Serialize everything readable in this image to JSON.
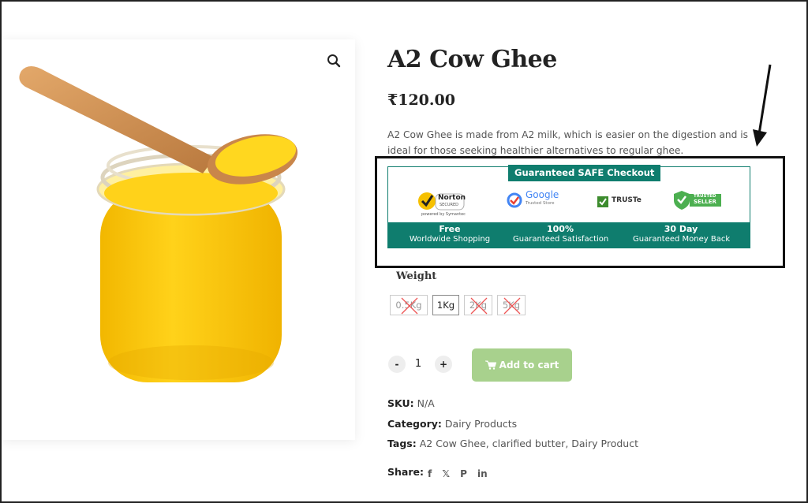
{
  "product": {
    "title": "A2 Cow Ghee",
    "price": "₹120.00",
    "description": "A2 Cow Ghee is made from A2 milk, which is easier on the digestion and is ideal for those seeking healthier alternatives to regular ghee."
  },
  "trust": {
    "heading": "Guaranteed SAFE Checkout",
    "logos": [
      {
        "name": "norton-secured-logo",
        "line1": "Norton",
        "line2": "SECURED",
        "line3": "powered by Symantec"
      },
      {
        "name": "google-trusted-store-logo",
        "line1": "Google",
        "line2": "Trusted Store"
      },
      {
        "name": "truste-logo",
        "line1": "TRUSTe"
      },
      {
        "name": "trusted-seller-logo",
        "line1": "TRUSTED",
        "line2": "SELLER"
      }
    ],
    "badges": [
      {
        "top": "Free",
        "sub": "Worldwide Shopping"
      },
      {
        "top": "100%",
        "sub": "Guaranteed Satisfaction"
      },
      {
        "top": "30 Day",
        "sub": "Guaranteed Money Back"
      }
    ]
  },
  "weight": {
    "label": "Weight",
    "options": [
      {
        "label": "0.5Kg",
        "available": false
      },
      {
        "label": "1Kg",
        "available": true
      },
      {
        "label": "2Kg",
        "available": false
      },
      {
        "label": "5Kg",
        "available": false
      }
    ]
  },
  "cart": {
    "minus": "-",
    "plus": "+",
    "quantity": "1",
    "add_label": "Add to cart"
  },
  "meta": {
    "sku_label": "SKU:",
    "sku_value": "N/A",
    "category_label": "Category:",
    "category_value": "Dairy Products",
    "tags_label": "Tags:",
    "tags": [
      "A2 Cow Ghee",
      "clarified butter",
      "Dairy Product"
    ],
    "share_label": "Share:",
    "share_icons": [
      "f",
      "𝕏",
      "P",
      "in"
    ]
  },
  "colors": {
    "teal": "#0f7d6e",
    "cart_button": "#a8d18d",
    "ghee_yellow": "#f9c800"
  }
}
